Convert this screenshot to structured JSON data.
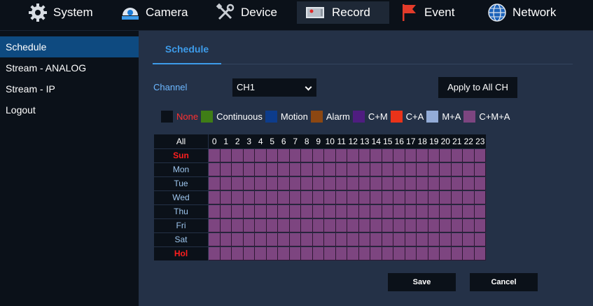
{
  "topnav": {
    "items": [
      {
        "label": "System",
        "icon": "gear-icon",
        "active": false
      },
      {
        "label": "Camera",
        "icon": "camera-icon",
        "active": false
      },
      {
        "label": "Device",
        "icon": "tools-icon",
        "active": false
      },
      {
        "label": "Record",
        "icon": "record-icon",
        "active": true
      },
      {
        "label": "Event",
        "icon": "flag-icon",
        "active": false
      },
      {
        "label": "Network",
        "icon": "globe-icon",
        "active": false
      }
    ]
  },
  "sidebar": {
    "items": [
      {
        "label": "Schedule",
        "active": true
      },
      {
        "label": "Stream - ANALOG",
        "active": false
      },
      {
        "label": "Stream - IP",
        "active": false
      },
      {
        "label": "Logout",
        "active": false
      }
    ]
  },
  "main": {
    "tab": "Schedule",
    "channel_label": "Channel",
    "channel_value": "CH1",
    "apply_label": "Apply to All CH",
    "save_label": "Save",
    "cancel_label": "Cancel"
  },
  "legend": [
    {
      "label": "None",
      "color": "#0b1119"
    },
    {
      "label": "Continuous",
      "color": "#3f7d16"
    },
    {
      "label": "Motion",
      "color": "#0d3c8c"
    },
    {
      "label": "Alarm",
      "color": "#8c4712"
    },
    {
      "label": "C+M",
      "color": "#4f1d80"
    },
    {
      "label": "C+A",
      "color": "#ea3319"
    },
    {
      "label": "M+A",
      "color": "#93acd8"
    },
    {
      "label": "C+M+A",
      "color": "#7d4580"
    }
  ],
  "grid": {
    "all_label": "All",
    "hours": [
      "0",
      "1",
      "2",
      "3",
      "4",
      "5",
      "6",
      "7",
      "8",
      "9",
      "10",
      "11",
      "12",
      "13",
      "14",
      "15",
      "16",
      "17",
      "18",
      "19",
      "20",
      "21",
      "22",
      "23"
    ],
    "days": [
      {
        "label": "Sun",
        "weekend": true
      },
      {
        "label": "Mon",
        "weekend": false
      },
      {
        "label": "Tue",
        "weekend": false
      },
      {
        "label": "Wed",
        "weekend": false
      },
      {
        "label": "Thu",
        "weekend": false
      },
      {
        "label": "Fri",
        "weekend": false
      },
      {
        "label": "Sat",
        "weekend": false
      },
      {
        "label": "Hol",
        "weekend": true
      }
    ],
    "fill_mode": "C+M+A"
  }
}
